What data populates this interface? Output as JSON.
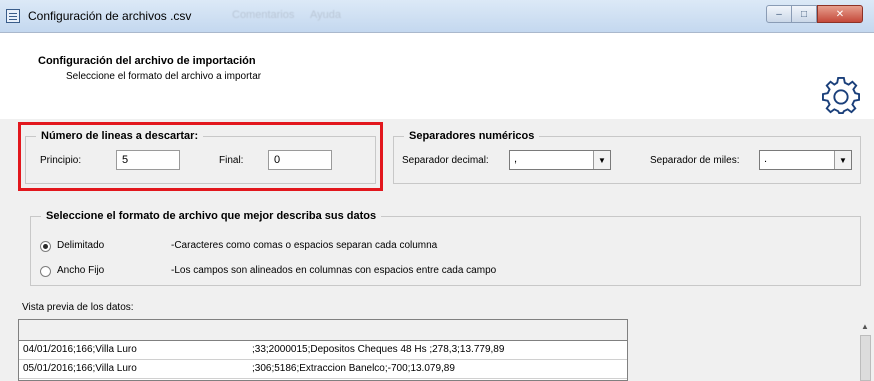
{
  "window": {
    "title": "Configuración de archivos .csv",
    "ghost_menu": [
      "Comentarios",
      "Ayuda"
    ],
    "controls": {
      "minimize": "–",
      "maximize": "□",
      "close": "✕"
    }
  },
  "header": {
    "title": "Configuración del archivo de importación",
    "subtitle": "Seleccione el formato del archivo a importar",
    "icon": "gear-icon"
  },
  "lines_to_discard": {
    "legend": "Número de lineas a descartar:",
    "start_label": "Principio:",
    "start_value": "5",
    "end_label": "Final:",
    "end_value": "0",
    "highlight_color": "#e2171d"
  },
  "numeric_separators": {
    "legend": "Separadores numéricos",
    "decimal_label": "Separador decimal:",
    "decimal_value": ",",
    "thousands_label": "Separador de miles:",
    "thousands_value": "."
  },
  "file_format": {
    "legend": "Seleccione el formato de archivo que mejor describa sus datos",
    "options": [
      {
        "label": "Delimitado",
        "description": "-Caracteres como comas o espacios separan cada columna",
        "checked": true
      },
      {
        "label": "Ancho Fijo",
        "description": "-Los campos son alineados en columnas con espacios entre cada campo",
        "checked": false
      }
    ]
  },
  "preview": {
    "label": "Vista previa de los datos:",
    "rows": [
      {
        "col1": "04/01/2016;166;Villa Luro",
        "col2": ";33;2000015;Depositos Cheques 48 Hs ;278,3;13.779,89"
      },
      {
        "col1": "05/01/2016;166;Villa Luro",
        "col2": ";306;5186;Extraccion Banelco;-700;13.079,89"
      }
    ]
  }
}
